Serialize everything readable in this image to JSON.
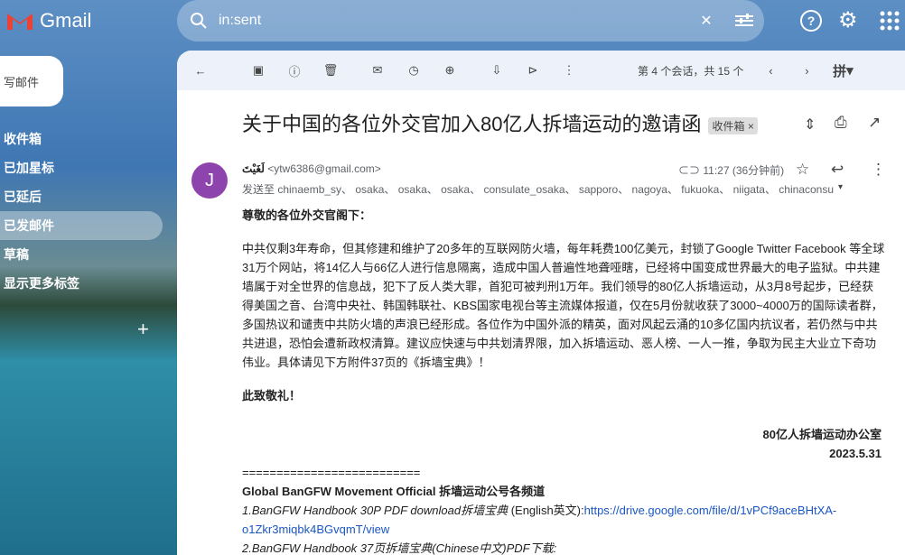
{
  "app": {
    "name": "Gmail",
    "search": "in:sent"
  },
  "sidebar": {
    "compose": "写邮件",
    "items": [
      "收件箱",
      "已加星标",
      "已延后",
      "已发邮件",
      "草稿",
      "显示更多标签"
    ]
  },
  "toolbar": {
    "pager": "第 4 个会话，共 15 个",
    "lang": "拼"
  },
  "mail": {
    "subject": "关于中国的各位外交官加入80亿人拆墙运动的邀请函",
    "badge": "收件箱",
    "badge_x": "×",
    "sender": "لَغَيْتَ",
    "email": "<ytw6386@gmail.com>",
    "avatar": "J",
    "time": "11:27 (36分钟前)",
    "to": "发送至 chinaemb_sy、 osaka、 osaka、 osaka、 consulate_osaka、 sapporo、 nagoya、 fukuoka、 niigata、 chinaconsu",
    "greeting": "尊敬的各位外交官阁下：",
    "para": "中共仅剩3年寿命，但其修建和维护了20多年的互联网防火墙，每年耗费100亿美元，封锁了Google Twitter Facebook 等全球31万个网站，将14亿人与66亿人进行信息隔离，造成中国人普遍性地聋哑瞎，已经将中国变成世界最大的电子监狱。中共建墙属于对全世界的信息战，犯下了反人类大罪，首犯可被判刑1万年。我们领导的80亿人拆墙运动，从3月8号起步，已经获得美国之音、台湾中央社、韩国韩联社、KBS国家电视台等主流媒体报道，仅在5月份就收获了3000~4000万的国际读者群，多国热议和谴责中共防火墙的声浪已经形成。各位作为中国外派的精英，面对风起云涌的10多亿国内抗议者，若仍然与中共共进退，恐怕会遭新政权清算。建议应快速与中共划清界限，加入拆墙运动、恶人榜、一人一推，争取为民主大业立下奇功伟业。具体请见下方附件37页的《拆墙宝典》！",
    "closing": "此致敬礼！",
    "sign": "80亿人拆墙运动办公室",
    "date": "2023.5.31",
    "sep": "==========================",
    "ch_title": "Global BanGFW Movement Official 拆墙运动公号各频道",
    "l1": "1.BanGFW Handbook 30P PDF download拆墙宝典",
    "l1b": " (English英文):",
    "l1url": "https://drive.google.com/file/d/1vPCf9aceBHtXA-o1Zkr3miqbk4BGvqmT/view",
    "l2": "2.BanGFW Handbook 37页拆墙宝典(Chinese中文)PDF下载:"
  }
}
